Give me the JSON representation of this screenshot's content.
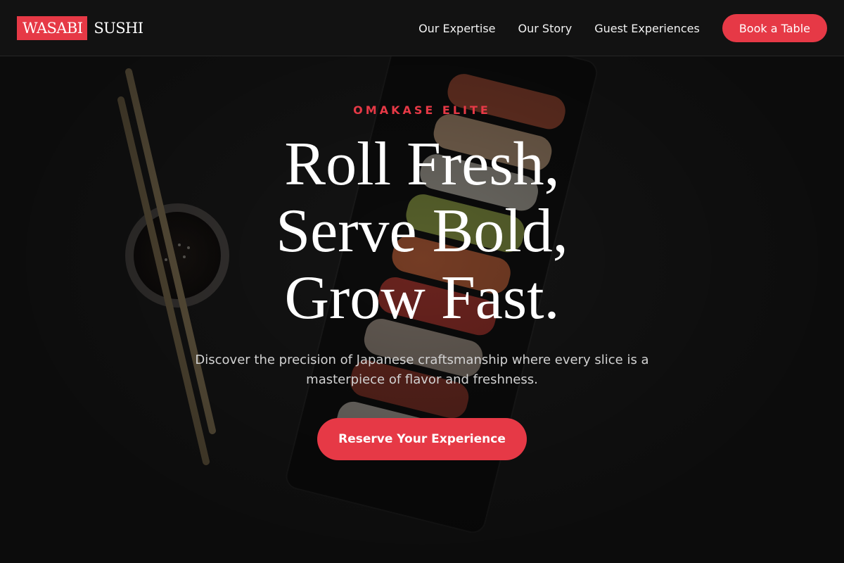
{
  "brand": {
    "badge": "WASABI",
    "text": "SUSHI",
    "accent_color": "#e63946"
  },
  "nav": {
    "links": [
      {
        "label": "Our Expertise"
      },
      {
        "label": "Our Story"
      },
      {
        "label": "Guest Experiences"
      }
    ],
    "cta_label": "Book a Table"
  },
  "hero": {
    "eyebrow": "OMAKASE ELITE",
    "headline": [
      "Roll Fresh,",
      "Serve Bold,",
      "Grow Fast."
    ],
    "subtext": "Discover the precision of Japanese craftsmanship where every slice is a masterpiece of flavor and freshness.",
    "cta_label": "Reserve Your Experience",
    "background_image": "sushi-platter-with-chopsticks-and-soy-sauce"
  }
}
